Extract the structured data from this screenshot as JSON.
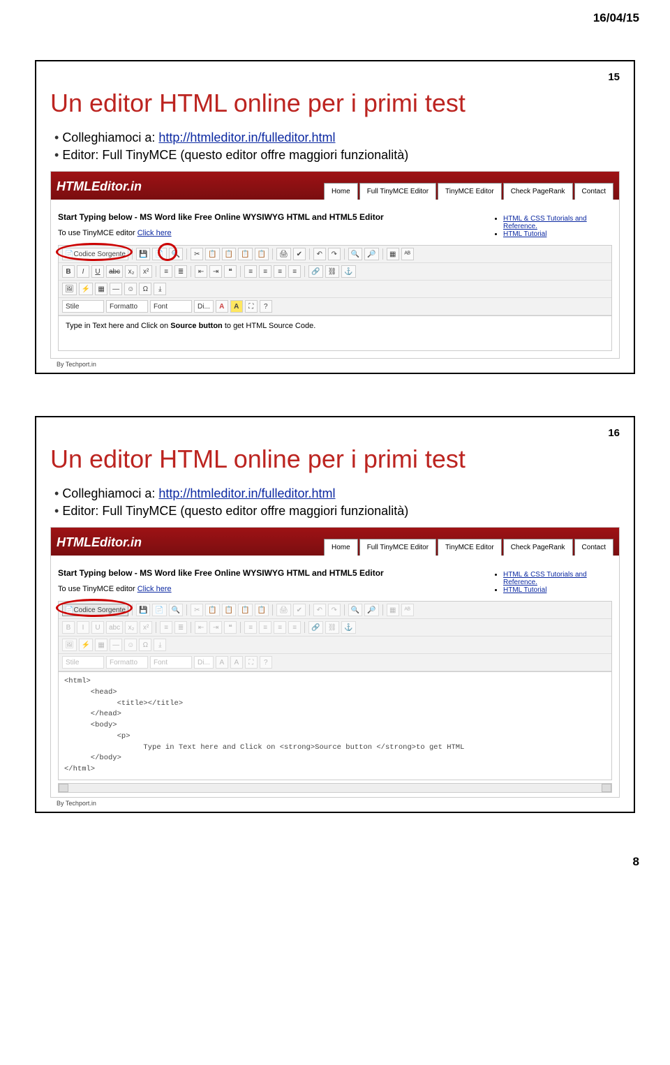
{
  "header_date": "16/04/15",
  "page_number": "8",
  "slides": [
    {
      "number": "15",
      "title": "Un editor HTML online per i primi test",
      "bullet1_prefix": "Colleghiamoci a: ",
      "bullet1_link": "http://htmleditor.in/fulleditor.html",
      "bullet2": "Editor: Full TinyMCE (questo editor offre maggiori funzionalità)",
      "shot": {
        "logo": "HTMLEditor.in",
        "by": "By Techport.in",
        "tabs": [
          "Home",
          "Full TinyMCE Editor",
          "TinyMCE Editor",
          "Check PageRank",
          "Contact"
        ],
        "left_heading": "Start Typing below - MS Word like Free Online WYSIWYG HTML and HTML5 Editor",
        "left_line_prefix": "To use TinyMCE editor ",
        "left_line_link": "Click here",
        "right_links": [
          "HTML & CSS Tutorials and Reference.",
          "HTML Tutorial"
        ],
        "toolbar": {
          "row1_source": "Codice Sorgente",
          "row2_items": [
            "B",
            "I",
            "U",
            "abc",
            "x₂",
            "x²"
          ],
          "row3_labels": [
            "Stile",
            "Formatto",
            "Font",
            "Di...",
            "A",
            "A"
          ]
        },
        "editor_text_pre": "Type in Text here and Click on ",
        "editor_text_bold": "Source button",
        "editor_text_post": " to get HTML Source Code."
      }
    },
    {
      "number": "16",
      "title": "Un editor HTML online per i primi test",
      "bullet1_prefix": "Colleghiamoci a: ",
      "bullet1_link": "http://htmleditor.in/fulleditor.html",
      "bullet2": "Editor: Full TinyMCE (questo editor offre maggiori funzionalità)",
      "shot": {
        "logo": "HTMLEditor.in",
        "by": "By Techport.in",
        "tabs": [
          "Home",
          "Full TinyMCE Editor",
          "TinyMCE Editor",
          "Check PageRank",
          "Contact"
        ],
        "left_heading": "Start Typing below - MS Word like Free Online WYSIWYG HTML and HTML5 Editor",
        "left_line_prefix": "To use TinyMCE editor ",
        "left_line_link": "Click here",
        "right_links": [
          "HTML & CSS Tutorials and Reference.",
          "HTML Tutorial"
        ],
        "toolbar": {
          "row1_source": "Codice Sorgente",
          "row2_items": [
            "B",
            "I",
            "U",
            "abc",
            "x₂",
            "x²"
          ],
          "row3_labels": [
            "Stile",
            "Formatto",
            "Font",
            "Di...",
            "A",
            "A"
          ]
        },
        "code": "<html>\n      <head>\n            <title></title>\n      </head>\n      <body>\n            <p>\n                  Type in Text here and Click on <strong>Source button </strong>to get HTML\n      </body>\n</html>"
      }
    }
  ]
}
